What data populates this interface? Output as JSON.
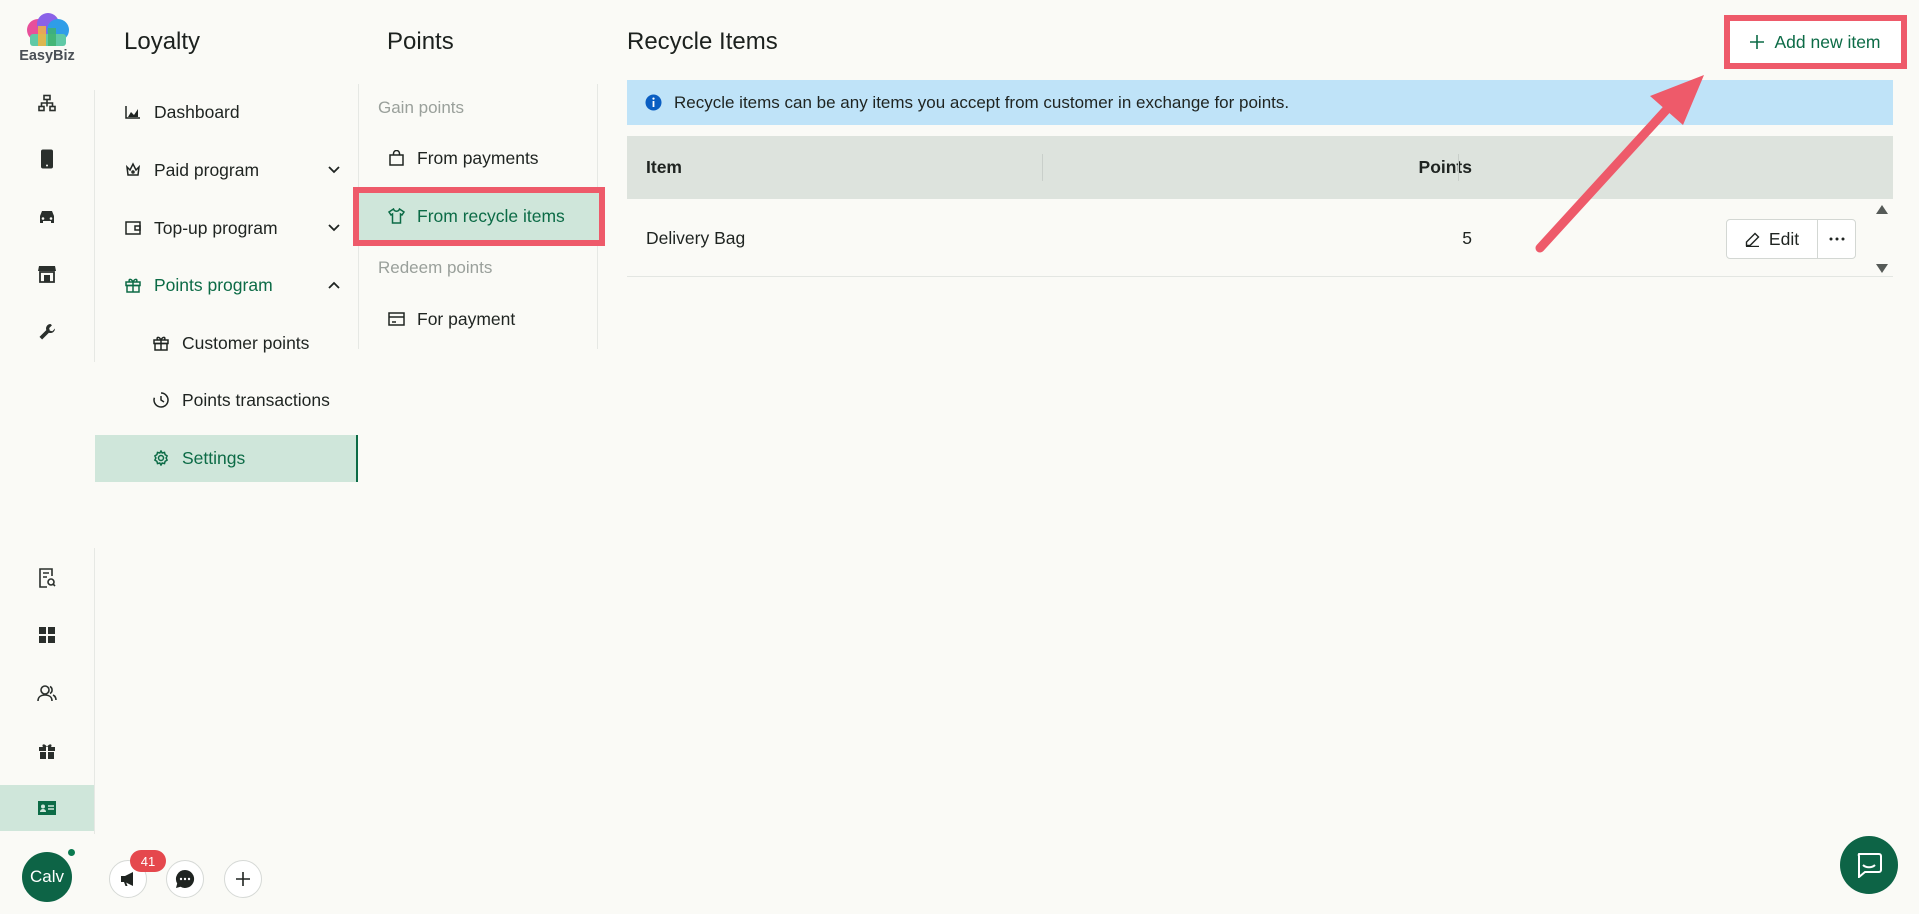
{
  "brand": {
    "name": "EasyBiz"
  },
  "rail": {
    "top_icons": [
      "sitemap-icon",
      "mobile-icon",
      "car-icon",
      "store-icon",
      "wrench-icon"
    ],
    "bottom_icons": [
      "report-search-icon",
      "grid-icon",
      "users-icon",
      "gift-icon",
      "id-card-icon"
    ],
    "active_icon": "id-card-icon",
    "user": {
      "initials": "Calv"
    }
  },
  "bottom_bar": {
    "notifications_count": "41",
    "icons": [
      "megaphone-icon",
      "chat-bubble-icon",
      "plus-icon"
    ]
  },
  "loyalty": {
    "title": "Loyalty",
    "items": [
      {
        "label": "Dashboard",
        "icon": "chart-area-icon"
      },
      {
        "label": "Paid program",
        "icon": "crown-icon",
        "expandable": true
      },
      {
        "label": "Top-up program",
        "icon": "wallet-icon",
        "expandable": true
      },
      {
        "label": "Points program",
        "icon": "gift-icon",
        "expanded": true
      },
      {
        "label": "Customer points",
        "icon": "gift-icon"
      },
      {
        "label": "Points transactions",
        "icon": "history-icon"
      },
      {
        "label": "Settings",
        "icon": "gear-icon",
        "active": true
      }
    ]
  },
  "points": {
    "title": "Points",
    "gain_label": "Gain points",
    "redeem_label": "Redeem points",
    "items": [
      {
        "label": "From payments",
        "icon": "shopping-bag-icon"
      },
      {
        "label": "From recycle items",
        "icon": "shirt-icon",
        "active": true
      },
      {
        "label": "For payment",
        "icon": "credit-card-icon"
      }
    ]
  },
  "main": {
    "title": "Recycle Items",
    "add_button": "Add new item",
    "info": "Recycle items can be any items you accept from customer in exchange for points.",
    "table": {
      "columns": [
        "Item",
        "Points"
      ],
      "rows": [
        {
          "item": "Delivery Bag",
          "points": "5"
        }
      ],
      "edit_label": "Edit"
    }
  },
  "colors": {
    "primary": "#0c6b46",
    "active_bg": "#cfe6da",
    "highlight": "#ee5a6a",
    "info_bg": "#bfe3f8",
    "table_header_bg": "#dde3dd"
  }
}
